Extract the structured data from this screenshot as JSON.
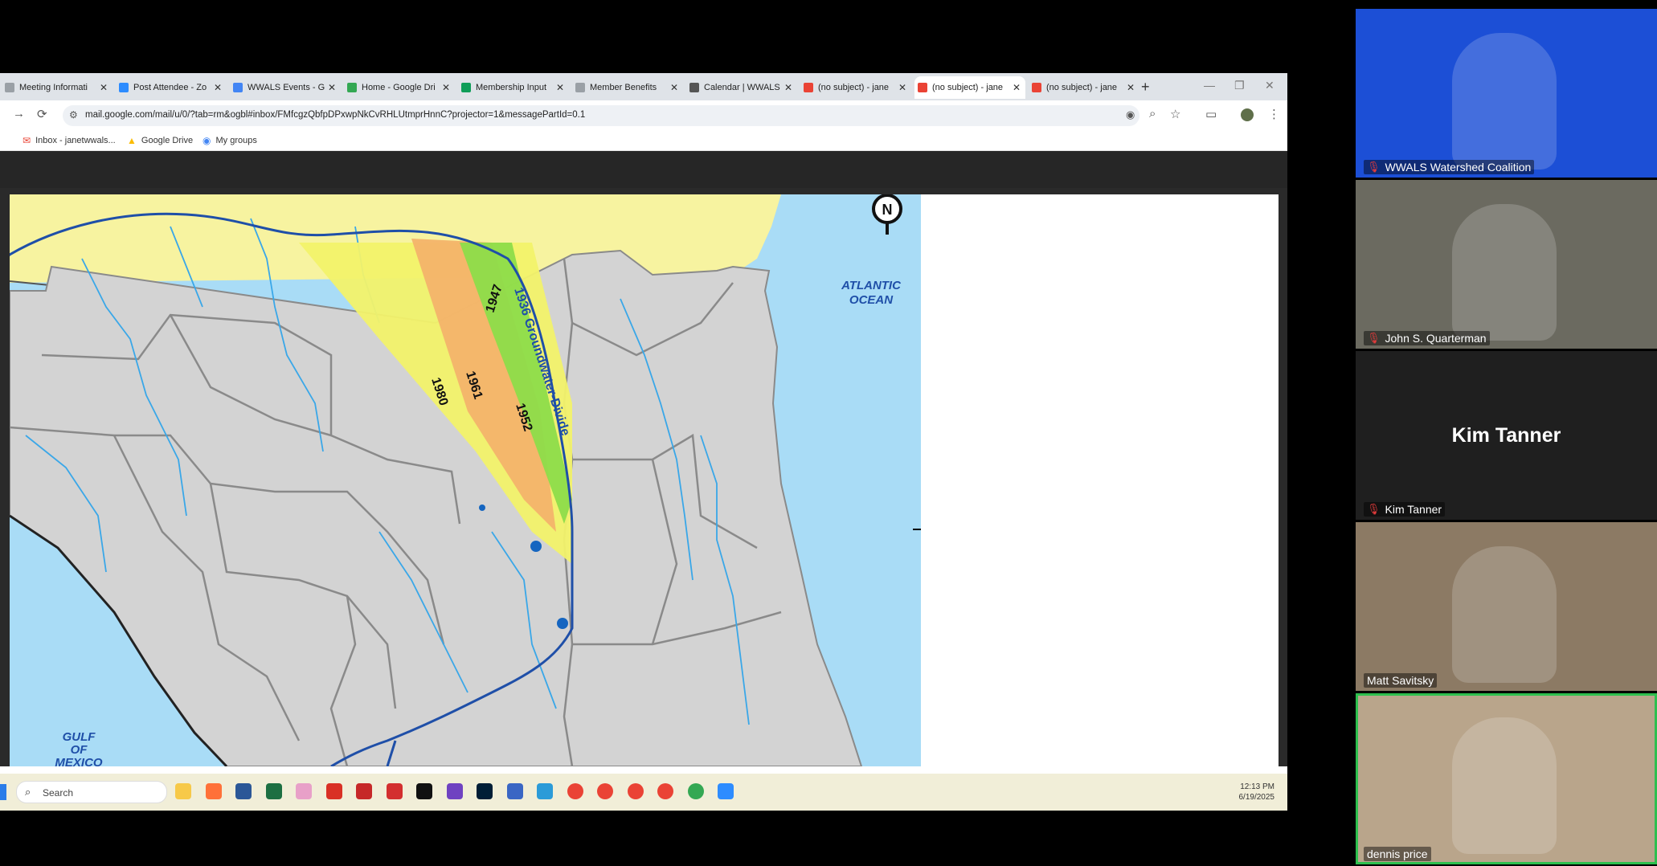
{
  "browser": {
    "tabs": [
      {
        "title": "Meeting Informati",
        "icon_color": "#9aa0a6"
      },
      {
        "title": "Post Attendee - Zo",
        "icon_color": "#2d8cff"
      },
      {
        "title": "WWALS Events - G",
        "icon_color": "#4285f4"
      },
      {
        "title": "Home - Google Dri",
        "icon_color": "#34a853"
      },
      {
        "title": "Membership Input",
        "icon_color": "#0f9d58"
      },
      {
        "title": "Member Benefits",
        "icon_color": "#9aa0a6"
      },
      {
        "title": "Calendar | WWALS",
        "icon_color": "#555555"
      },
      {
        "title": "(no subject) - jane",
        "icon_color": "#ea4335"
      },
      {
        "title": "(no subject) - jane",
        "icon_color": "#ea4335",
        "active": true
      },
      {
        "title": "(no subject) - jane",
        "icon_color": "#ea4335"
      }
    ],
    "new_tab": "+",
    "url": "mail.google.com/mail/u/0/?tab=rm&ogbl#inbox/FMfcgzQbfpDPxwpNkCvRHLUtmprHnnC?projector=1&messagePartId=0.1",
    "bookmarks": [
      {
        "label": "Inbox - janetwwals...",
        "icon": "gmail-icon"
      },
      {
        "label": "Google Drive",
        "icon": "drive-icon"
      },
      {
        "label": "My groups",
        "icon": "groups-icon"
      }
    ]
  },
  "map": {
    "ocean_label": [
      "ATLANTIC",
      "OCEAN"
    ],
    "gulf_label": [
      "GULF",
      "OF",
      "MEXICO"
    ],
    "divide_label": "1936 Groundwater-Divide",
    "years": [
      "1947",
      "1961",
      "1980",
      "1952"
    ],
    "north_label": "N",
    "colors": {
      "ocean": "#a9dcf6",
      "land_north": "#f7f3a0",
      "counties": "#d3d3d3",
      "boundary": "#808080",
      "divide": "#1f4fa8",
      "band_1980": "#f2f26a",
      "band_1961": "#f3b36a",
      "band_1952": "#8ddc4a",
      "rivers": "#3aa7e8"
    }
  },
  "taskbar": {
    "search": "Search",
    "time": "12:13 PM",
    "date": "6/19/2025",
    "apps": [
      "#f7c948",
      "#ff7139",
      "#2b5797",
      "#1d6f42",
      "#e8a0c8",
      "#d93025",
      "#c62828",
      "#d32f2f",
      "#111111",
      "#6f42c1",
      "#001e36",
      "#3a66c4",
      "#2b9bd8",
      "#ea4335",
      "#ea4335",
      "#ea4335",
      "#ea4335",
      "#34a853",
      "#2d8cff"
    ]
  },
  "participants": [
    {
      "name": "WWALS Watershed Coalition",
      "muted": true,
      "bg": "#1c4fd6"
    },
    {
      "name": "John S. Quarterman",
      "muted": true,
      "bg": "#6b6a60"
    },
    {
      "name": "Kim Tanner",
      "muted": true,
      "bg": "#1f1f1f",
      "display": "Kim Tanner"
    },
    {
      "name": "Matt Savitsky",
      "muted": false,
      "bg": "#8c7a64"
    },
    {
      "name": "dennis price",
      "muted": false,
      "bg": "#b9a58b",
      "speaking": true
    }
  ]
}
